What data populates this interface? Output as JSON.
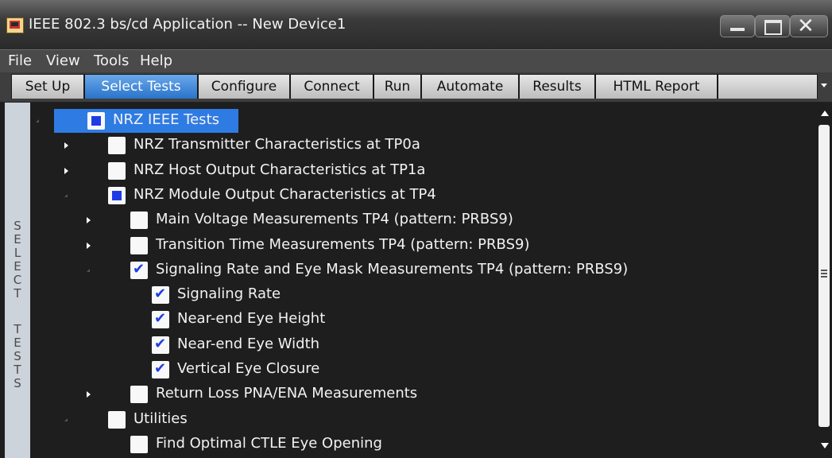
{
  "window": {
    "title": "IEEE 802.3 bs/cd Application -- New Device1"
  },
  "menu": [
    "File",
    "View",
    "Tools",
    "Help"
  ],
  "tabs": [
    {
      "label": "Set Up",
      "active": false
    },
    {
      "label": "Select Tests",
      "active": true
    },
    {
      "label": "Configure",
      "active": false
    },
    {
      "label": "Connect",
      "active": false
    },
    {
      "label": "Run",
      "active": false
    },
    {
      "label": "Automate",
      "active": false
    },
    {
      "label": "Results",
      "active": false
    },
    {
      "label": "HTML Report",
      "active": false
    }
  ],
  "side_panel": {
    "label": "SELECT TESTS"
  },
  "tree": [
    {
      "label": "NRZ IEEE Tests",
      "level": 0,
      "arrow": "expanded",
      "check": "partial",
      "selected": true
    },
    {
      "label": "NRZ Transmitter Characteristics at TP0a",
      "level": 1,
      "arrow": "collapsed",
      "check": "unchecked"
    },
    {
      "label": "NRZ Host Output Characteristics at TP1a",
      "level": 1,
      "arrow": "collapsed",
      "check": "unchecked"
    },
    {
      "label": "NRZ Module Output Characteristics at TP4",
      "level": 1,
      "arrow": "expanded",
      "check": "partial"
    },
    {
      "label": "Main Voltage Measurements TP4 (pattern: PRBS9)",
      "level": 2,
      "arrow": "collapsed",
      "check": "unchecked"
    },
    {
      "label": "Transition Time Measurements TP4 (pattern: PRBS9)",
      "level": 2,
      "arrow": "collapsed",
      "check": "unchecked"
    },
    {
      "label": "Signaling Rate and Eye Mask Measurements TP4 (pattern: PRBS9)",
      "level": 2,
      "arrow": "expanded",
      "check": "checked"
    },
    {
      "label": "Signaling Rate",
      "level": 3,
      "arrow": "none",
      "check": "checked"
    },
    {
      "label": "Near-end Eye Height",
      "level": 3,
      "arrow": "none",
      "check": "checked"
    },
    {
      "label": "Near-end Eye Width",
      "level": 3,
      "arrow": "none",
      "check": "checked"
    },
    {
      "label": "Vertical Eye Closure",
      "level": 3,
      "arrow": "none",
      "check": "checked"
    },
    {
      "label": "Return Loss PNA/ENA Measurements",
      "level": 2,
      "arrow": "collapsed",
      "check": "unchecked"
    },
    {
      "label": "Utilities",
      "level": 1,
      "arrow": "expanded",
      "check": "unchecked"
    },
    {
      "label": "Find Optimal CTLE Eye Opening",
      "level": 2,
      "arrow": "none",
      "check": "unchecked"
    }
  ]
}
